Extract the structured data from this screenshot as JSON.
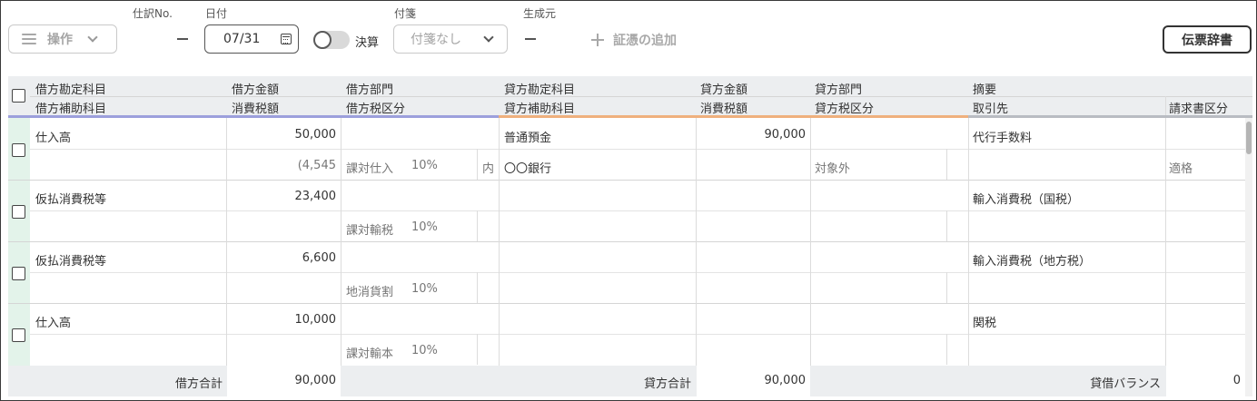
{
  "toolbar": {
    "operations_label": "操作",
    "journal_no_label": "仕訳No.",
    "journal_no_value": "–",
    "date_label": "日付",
    "date_value": "07/31",
    "closing_label": "決算",
    "closing_on": false,
    "sticky_label": "付箋",
    "sticky_value": "付箋なし",
    "source_label": "生成元",
    "source_value": "–",
    "add_evidence_label": "証憑の追加",
    "dictionary_label": "伝票辞書"
  },
  "table": {
    "headers_top": [
      "借方勘定科目",
      "借方金額",
      "借方部門",
      "貸方勘定科目",
      "貸方金額",
      "貸方部門",
      "摘要"
    ],
    "headers_bottom": [
      "借方補助科目",
      "消費税額",
      "借方税区分",
      "貸方補助科目",
      "消費税額",
      "貸方税区分",
      "取引先",
      "請求書区分"
    ],
    "rows": [
      {
        "debit_account": "仕入高",
        "debit_amount": "50,000",
        "debit_dept": "",
        "credit_account": "普通預金",
        "credit_amount": "90,000",
        "credit_dept": "",
        "memo": "代行手数料",
        "debit_sub": "",
        "debit_tax": "(4,545",
        "debit_tax_class": "課対仕入",
        "debit_tax_rate": "10%",
        "debit_tax_kind": "内",
        "credit_sub": "〇〇銀行",
        "credit_tax": "",
        "credit_tax_class": "対象外",
        "credit_tax_rate": "",
        "partner": "",
        "invoice_type": "適格"
      },
      {
        "debit_account": "仮払消費税等",
        "debit_amount": "23,400",
        "debit_dept": "",
        "credit_account": "",
        "credit_amount": "",
        "credit_dept": "",
        "memo": "輸入消費税（国税）",
        "debit_sub": "",
        "debit_tax": "",
        "debit_tax_class": "課対輸税",
        "debit_tax_rate": "10%",
        "debit_tax_kind": "",
        "credit_sub": "",
        "credit_tax": "",
        "credit_tax_class": "",
        "credit_tax_rate": "",
        "partner": "",
        "invoice_type": ""
      },
      {
        "debit_account": "仮払消費税等",
        "debit_amount": "6,600",
        "debit_dept": "",
        "credit_account": "",
        "credit_amount": "",
        "credit_dept": "",
        "memo": "輸入消費税（地方税）",
        "debit_sub": "",
        "debit_tax": "",
        "debit_tax_class": "地消貨割",
        "debit_tax_rate": "10%",
        "debit_tax_kind": "",
        "credit_sub": "",
        "credit_tax": "",
        "credit_tax_class": "",
        "credit_tax_rate": "",
        "partner": "",
        "invoice_type": ""
      },
      {
        "debit_account": "仕入高",
        "debit_amount": "10,000",
        "debit_dept": "",
        "credit_account": "",
        "credit_amount": "",
        "credit_dept": "",
        "memo": "関税",
        "debit_sub": "",
        "debit_tax": "",
        "debit_tax_class": "課対輸本",
        "debit_tax_rate": "10%",
        "debit_tax_kind": "",
        "credit_sub": "",
        "credit_tax": "",
        "credit_tax_class": "",
        "credit_tax_rate": "",
        "partner": "",
        "invoice_type": ""
      }
    ],
    "footer": {
      "debit_total_label": "借方合計",
      "debit_total": "90,000",
      "credit_total_label": "貸方合計",
      "credit_total": "90,000",
      "balance_label": "貸借バランス",
      "balance": "0"
    }
  },
  "colors": {
    "debit_accent": "#9c9fdc",
    "credit_accent": "#efb07d",
    "memo_accent": "#b9bcc2",
    "row_marker": "#e3f3ea"
  }
}
